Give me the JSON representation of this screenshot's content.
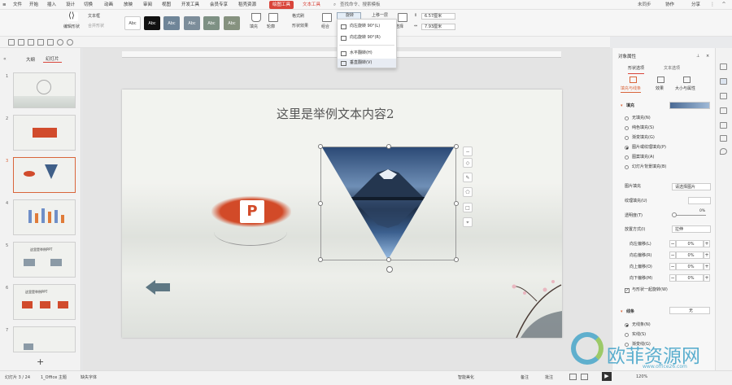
{
  "menubar": {
    "app_menu": "文件",
    "items": [
      "开始",
      "插入",
      "设计",
      "切换",
      "动画",
      "放映",
      "审阅",
      "视图",
      "开发工具",
      "会员专享",
      "稻壳资源"
    ],
    "context_tab_picture": "绘图工具",
    "context_tab_text": "文本工具",
    "search": "查找命令、搜索模板",
    "status_unsynced": "未同步",
    "collab": "协作",
    "share": "分享"
  },
  "ribbon": {
    "edit_shape": "编辑形状",
    "textbox": "文本框",
    "merge_shapes": "合并形状",
    "style_label": "Abc",
    "fill": "填充",
    "outline": "轮廓",
    "format_painter": "格式刷",
    "shape_effects": "形状效果",
    "group": "组合",
    "rotate": "旋转",
    "bring_forward": "上移一层",
    "align": "对齐",
    "select": "选择",
    "height_value": "6.57厘米",
    "width_value": "7.93厘米"
  },
  "rotate_menu": {
    "items": [
      {
        "label": "向左旋转 90°(L)"
      },
      {
        "label": "向右旋转 90°(R)"
      },
      {
        "label": "水平翻转(H)"
      },
      {
        "label": "垂直翻转(V)"
      }
    ]
  },
  "leftpanel": {
    "tab_outline": "大纲",
    "tab_slides": "幻灯片",
    "slides": [
      {
        "num": "1"
      },
      {
        "num": "2"
      },
      {
        "num": "3"
      },
      {
        "num": "4"
      },
      {
        "num": "5",
        "caption": "这里是举例PPT"
      },
      {
        "num": "6",
        "caption": "这里是举例PPT"
      },
      {
        "num": "7"
      }
    ],
    "add_slide": "+"
  },
  "slide": {
    "title": "这里是举例文本内容2"
  },
  "rightpanel": {
    "header": "对象属性",
    "tab_shape": "形状选项",
    "tab_text": "文本选项",
    "subtab_fill": "填充与线条",
    "subtab_effect": "效果",
    "subtab_size": "大小与属性",
    "section_fill": "填充",
    "fill_options": [
      "无填充(N)",
      "纯色填充(S)",
      "渐变填充(G)",
      "图片或纹理填充(P)",
      "图案填充(A)",
      "幻灯片背景填充(B)"
    ],
    "picture_fill": "图片填充",
    "picture_fill_value": "请选择图片",
    "texture_fill": "纹理填充(U)",
    "transparency": "透明度(T)",
    "transparency_value": "0%",
    "placement": "放置方式(I)",
    "placement_value": "拉伸",
    "offset_left": "向左偏移(L)",
    "offset_right": "向右偏移(R)",
    "offset_up": "向上偏移(O)",
    "offset_down": "向下偏移(M)",
    "offset_value": "0%",
    "rotate_with_shape": "与形状一起旋转(W)",
    "section_line": "线条",
    "line_value": "无",
    "line_options": [
      "无线条(N)",
      "实线(S)",
      "渐变线(G)"
    ]
  },
  "statusbar": {
    "slide_pos": "幻灯片 3 / 24",
    "theme": "1_Office 主题",
    "missing_font": "缺失字体",
    "smart_beautify": "智能美化",
    "notes": "备注",
    "comments": "批注",
    "zoom": "120%"
  },
  "watermark": {
    "main": "欧菲资源网",
    "sub": "www.office26.com"
  },
  "colors": {
    "accent_red": "#d9453b",
    "selection_orange": "#d9653b"
  }
}
